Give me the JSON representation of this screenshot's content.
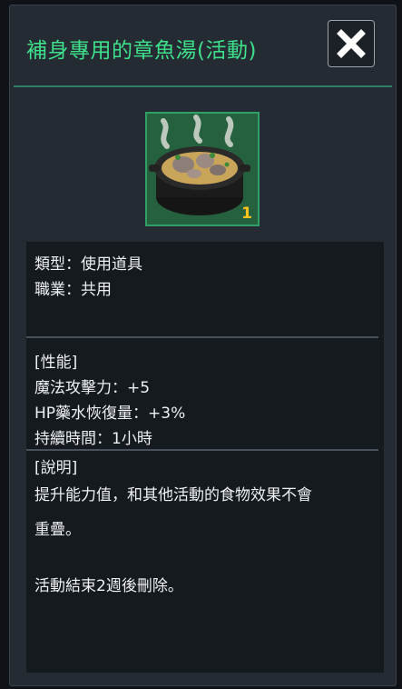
{
  "dialog": {
    "title": "補身專用的章魚湯(活動)",
    "close_icon": "close-x-icon"
  },
  "item": {
    "icon": "octopus-soup-pot-icon",
    "quantity": "1"
  },
  "basic": {
    "type_line": "類型：使用道具",
    "job_line": "職業：共用"
  },
  "stats": {
    "header": "[性能]",
    "magic_attack": "魔法攻擊力：+5",
    "hp_recovery": "HP藥水恢復量：+3%",
    "duration": "持續時間：1小時"
  },
  "description": {
    "header": "[說明]",
    "line1": "提升能力值，和其他活動的食物效果不會",
    "line2": "重疊。",
    "line3": "活動結束2週後刪除。"
  },
  "colors": {
    "title_green": "#3fe08c",
    "quantity_yellow": "#ffc21a",
    "panel_bg": "#242b32",
    "info_bg": "#151a1f"
  }
}
